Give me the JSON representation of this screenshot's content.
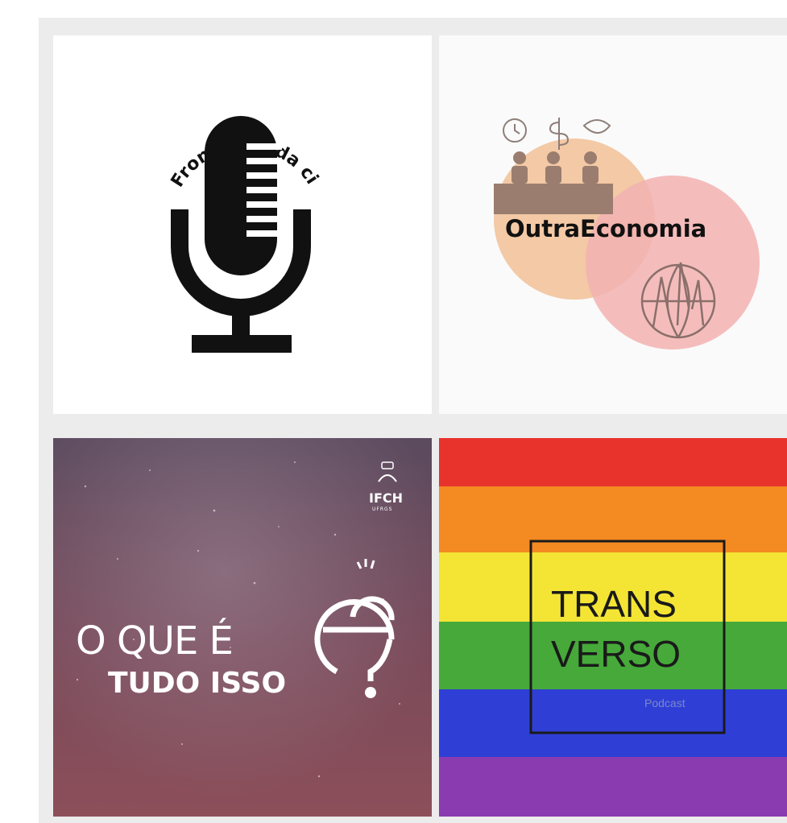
{
  "podcasts": [
    {
      "name": "fronteiras-da-ciencia",
      "arc_text": "Fronteiras da ciência"
    },
    {
      "name": "outra-economia",
      "title": "OutraEconomia"
    },
    {
      "name": "o-que-e-tudo-isso",
      "line1": "O QUE É",
      "line2": "TUDO ISSO",
      "badge": "IFCH",
      "badge_sub": "UFRGS"
    },
    {
      "name": "transverso",
      "line1": "TRANS",
      "line2": "VERSO",
      "sub": "Podcast"
    }
  ],
  "colors": {
    "outra_peach": "#f3c9a6",
    "outra_pink": "#f2b2b0",
    "outra_brown": "#9a7d6e",
    "sky_top": "#5b4a5e",
    "sky_bottom": "#8c4f5a",
    "rainbow": [
      "#e8332d",
      "#f48a22",
      "#f4e534",
      "#46a93a",
      "#2f3fd6",
      "#8a3bb0"
    ]
  }
}
